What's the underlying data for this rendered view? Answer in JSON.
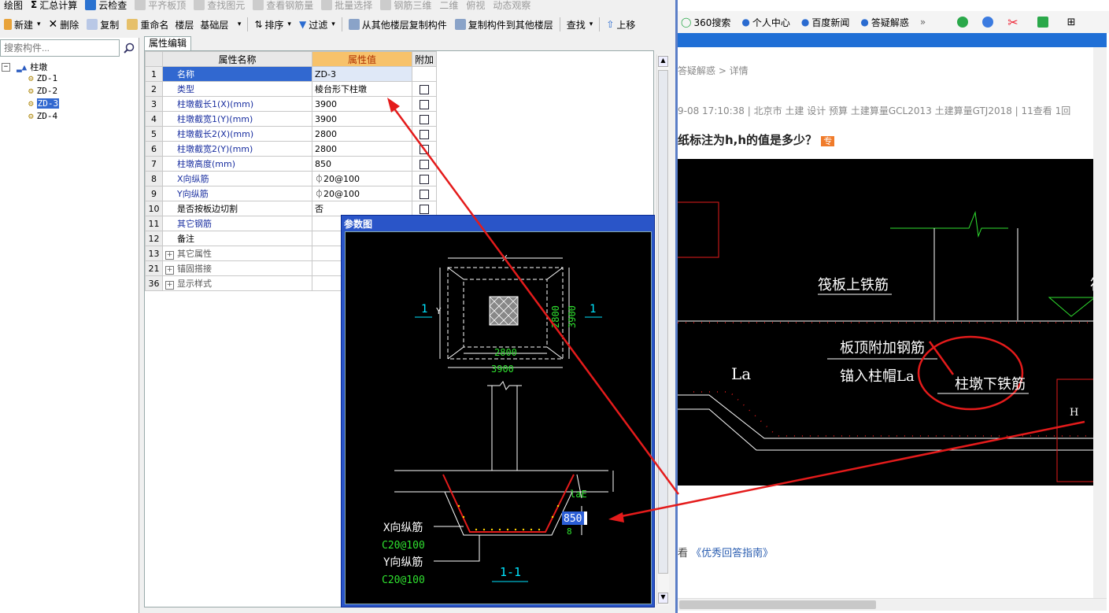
{
  "toolbar1": {
    "draw": "绘图",
    "sum_calc": "汇总计算",
    "cloud_check": "云检查",
    "flat_top": "平齐板顶",
    "find_elem": "查找图元",
    "view_rebar": "查看钢筋量",
    "batch_select": "批量选择",
    "rebar_3d": "钢筋三维",
    "view_2d": "二维",
    "view_mode": "俯视",
    "dynamic_view": "动态观察"
  },
  "toolbar2": {
    "new": "新建",
    "delete": "删除",
    "copy": "复制",
    "rename": "重命名",
    "floor_label": "楼层",
    "floor_value": "基础层",
    "sort": "排序",
    "filter": "过滤",
    "copy_from_floor": "从其他楼层复制构件",
    "copy_to_floor": "复制构件到其他楼层",
    "find": "查找",
    "move_up": "上移"
  },
  "tree": {
    "search_placeholder": "搜索构件...",
    "root": "柱墩",
    "items": [
      "ZD-1",
      "ZD-2",
      "ZD-3",
      "ZD-4"
    ],
    "selected": "ZD-3"
  },
  "props": {
    "tab": "属性编辑",
    "headers": {
      "num": "",
      "name": "属性名称",
      "value": "属性值",
      "extra": "附加"
    },
    "rows": [
      {
        "num": "1",
        "name": "名称",
        "value": "ZD-3"
      },
      {
        "num": "2",
        "name": "类型",
        "value": "棱台形下柱墩"
      },
      {
        "num": "3",
        "name": "柱墩截长1(X)(mm)",
        "value": "3900"
      },
      {
        "num": "4",
        "name": "柱墩截宽1(Y)(mm)",
        "value": "3900"
      },
      {
        "num": "5",
        "name": "柱墩截长2(X)(mm)",
        "value": "2800"
      },
      {
        "num": "6",
        "name": "柱墩截宽2(Y)(mm)",
        "value": "2800"
      },
      {
        "num": "7",
        "name": "柱墩高度(mm)",
        "value": "850"
      },
      {
        "num": "8",
        "name": "X向纵筋",
        "value": "⏀20@100"
      },
      {
        "num": "9",
        "name": "Y向纵筋",
        "value": "⏀20@100"
      },
      {
        "num": "10",
        "name": "是否按板边切割",
        "value": "否"
      },
      {
        "num": "11",
        "name": "其它钢筋",
        "value": ""
      },
      {
        "num": "12",
        "name": "备注",
        "value": ""
      },
      {
        "num": "13",
        "name": "其它属性",
        "value": ""
      },
      {
        "num": "21",
        "name": "锚固搭接",
        "value": ""
      },
      {
        "num": "36",
        "name": "显示样式",
        "value": ""
      }
    ]
  },
  "param_dialog": {
    "title": "参数图",
    "dim_x": "X",
    "dim_y": "Y",
    "dim_3900_top": "3900",
    "dim_2800_right": "2800",
    "dim_2800_bottom": "2800",
    "dim_3900_bottom": "3900",
    "section_marker": "1",
    "lae": "laE",
    "height_value": "850",
    "height_symbol": "8",
    "x_rebar_label": "X向纵筋",
    "x_rebar_value": "C20@100",
    "y_rebar_label": "Y向纵筋",
    "y_rebar_value": "C20@100",
    "section_label": "1-1"
  },
  "browser": {
    "toolbar": [
      "360搜索",
      "个人中心",
      "百度新闻",
      "答疑解惑"
    ],
    "breadcrumb": "答疑解惑 > 详情",
    "meta": "9-08 17:10:38    |    北京市  土建 设计 预算 土建算量GCL2013 土建算量GTJ2018    |    11查看  1回",
    "question": "纸标注为h,h的值是多少？",
    "badge": "专",
    "cad_labels": {
      "raft_top": "筏板上铁筋",
      "raft_top2": "筏板",
      "slab_add": "板顶附加钢筋",
      "anchor": "锚入柱帽La",
      "pier_bottom": "柱墩下铁筋",
      "la": "La",
      "h": "H"
    },
    "footer_prefix": "看",
    "footer_link": "《优秀回答指南》"
  },
  "colors": {
    "accent_blue": "#1f6fd6",
    "arrow_red": "#e41b1b",
    "cad_cyan": "#00e5ff",
    "cad_green": "#2fe02f"
  }
}
